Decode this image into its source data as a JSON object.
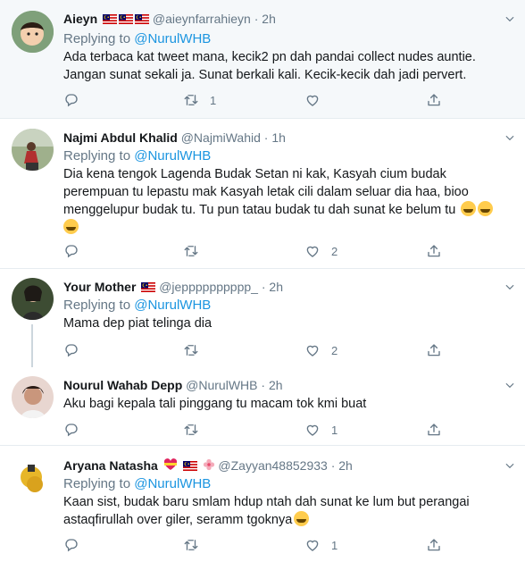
{
  "tweets": [
    {
      "name": "Aieyn",
      "handle": "@aieynfarrahieyn",
      "dot": "·",
      "time": "2h",
      "replying_prefix": "Replying to",
      "replying_to": "@NurulWHB",
      "text_lines": [
        "Ada terbaca kat tweet mana, kecik2 pn dah pandai collect nudes auntie.",
        "Jangan sunat sekali ja. Sunat berkali kali. Kecik-kecik dah jadi pervert."
      ],
      "reply_count": "",
      "retweet_count": "1",
      "like_count": "",
      "avatar_color": "#8bb08a"
    },
    {
      "name": "Najmi Abdul Khalid",
      "handle": "@NajmiWahid",
      "dot": "·",
      "time": "1h",
      "replying_prefix": "Replying to",
      "replying_to": "@NurulWHB",
      "text_lines": [
        "Dia kena tengok Lagenda Budak Setan ni kak, Kasyah cium budak",
        "perempuan tu lepastu mak Kasyah letak cili dalam seluar dia haa, bioo",
        "menggelupur budak tu. Tu pun tatau budak tu dah sunat ke belum tu"
      ],
      "reply_count": "",
      "retweet_count": "",
      "like_count": "2",
      "avatar_color": "#7a8f6a"
    },
    {
      "name": "Your Mother",
      "handle": "@jepppppppppp_",
      "dot": "·",
      "time": "2h",
      "replying_prefix": "Replying to",
      "replying_to": "@NurulWHB",
      "text_lines": [
        "Mama dep piat telinga dia"
      ],
      "reply_count": "",
      "retweet_count": "",
      "like_count": "2",
      "avatar_color": "#4a5a3c"
    },
    {
      "name": "Nourul Wahab Depp",
      "handle": "@NurulWHB",
      "dot": "·",
      "time": "2h",
      "text_lines": [
        "Aku bagi kepala tali pinggang tu macam tok kmi buat"
      ],
      "reply_count": "",
      "retweet_count": "",
      "like_count": "1",
      "avatar_color": "#c9a79a"
    },
    {
      "name": "Aryana Natasha",
      "handle": "@Zayyan48852933",
      "dot": "·",
      "time": "2h",
      "replying_prefix": "Replying to",
      "replying_to": "@NurulWHB",
      "text_lines": [
        "Kaan sist, budak baru smlam hdup ntah dah sunat ke lum but perangai",
        "astaqfirullah over giler, seramm tgoknya"
      ],
      "reply_count": "",
      "retweet_count": "",
      "like_count": "1",
      "avatar_color": "#e5b93a"
    }
  ],
  "colors": {
    "link": "#1b95e0",
    "muted": "#657786",
    "divider": "#e6ecf0",
    "highlight_bg": "#f5f8fa"
  },
  "icons": [
    "reply-icon",
    "retweet-icon",
    "like-icon",
    "share-icon",
    "chevron-down-icon",
    "malaysia-flag-icon",
    "laughing-emoji-icon",
    "scream-emoji-icon",
    "heart-ribbon-icon",
    "flower-icon"
  ]
}
